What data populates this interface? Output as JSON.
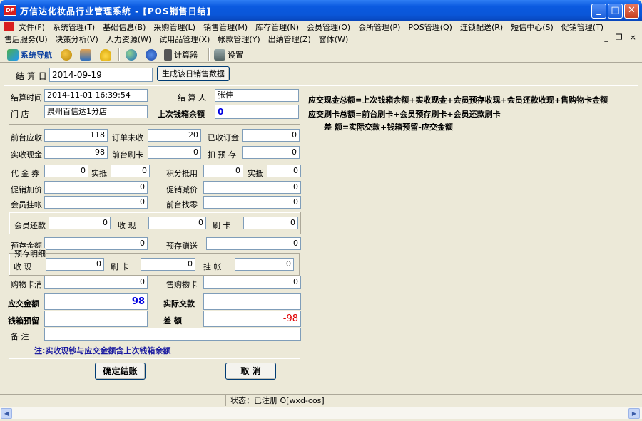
{
  "window": {
    "title": "万信达化妆品行业管理系统 - [POS销售日结]",
    "logo_text": "DF",
    "min_label": "_",
    "max_label": "□",
    "close_label": "✕"
  },
  "menu": {
    "row1": [
      "文件(F)",
      "系统管理(T)",
      "基础信息(B)",
      "采购管理(L)",
      "销售管理(M)",
      "库存管理(N)",
      "会员管理(O)",
      "会所管理(P)",
      "POS管理(Q)",
      "连锁配送(R)",
      "短信中心(S)",
      "促销管理(T)"
    ],
    "row2": [
      "售后服务(U)",
      "决策分析(V)",
      "人力资源(W)",
      "试用品管理(X)",
      "帐款管理(Y)",
      "出纳管理(Z)",
      "窗体(W)"
    ],
    "mdi": {
      "min": "_",
      "restore": "❐",
      "close": "×"
    }
  },
  "toolbar": {
    "nav_label": "系统导航",
    "calc_label": "计算器",
    "settings_label": "设置"
  },
  "form": {
    "settle_date_label": "结 算 日",
    "settle_date_value": "2014-09-19",
    "generate_btn": "生成该日销售数据",
    "settle_time_label": "结算时间",
    "settle_time_value": "2014-11-01 16:39:54",
    "settler_label": "结 算 人",
    "settler_value": "张佳",
    "store_label": "门    店",
    "store_value": "泉州百信达1分店",
    "last_cash_label": "上次钱箱余额",
    "last_cash_value": "0",
    "front_receivable_label": "前台应收",
    "front_receivable_value": "118",
    "unpaid_orders_label": "订单未收",
    "unpaid_orders_value": "20",
    "received_orders_label": "已收订金",
    "received_orders_value": "0",
    "cash_received_label": "实收现金",
    "cash_received_value": "98",
    "front_card_label": "前台刷卡",
    "front_card_value": "0",
    "prepaid_deduct_label": "扣 预 存",
    "prepaid_deduct_value": "0",
    "voucher_label": "代 金 券",
    "voucher_value": "0",
    "actual_offset_label": "实抵",
    "actual_offset_value": "0",
    "points_offset_label": "积分抵用",
    "points_offset_value": "0",
    "actual_offset2_label": "实抵",
    "actual_offset2_value": "0",
    "promo_markup_label": "促销加价",
    "promo_markup_value": "0",
    "promo_discount_label": "促销减价",
    "promo_discount_value": "0",
    "member_credit_label": "会员挂帐",
    "member_credit_value": "0",
    "front_change_label": "前台找零",
    "front_change_value": "0",
    "member_repay_label": "会员还款",
    "member_repay_value": "0",
    "repay_cash_label": "收    现",
    "repay_cash_value": "0",
    "repay_card_label": "刷    卡",
    "repay_card_value": "0",
    "prepaid_amount_label": "预存金额",
    "prepaid_amount_value": "0",
    "prepaid_gift_label": "预存赠送",
    "prepaid_gift_value": "0",
    "prepaid_detail_label": "预存明细",
    "detail_cash_label": "收    现",
    "detail_cash_value": "0",
    "detail_card_label": "刷    卡",
    "detail_card_value": "0",
    "detail_credit_label": "挂    帐",
    "detail_credit_value": "0",
    "card_consume_label": "购物卡消",
    "card_consume_value": "0",
    "card_sold_label": "售购物卡",
    "card_sold_value": "0",
    "due_label": "应交金额",
    "due_value": "98",
    "actual_paid_label": "实际交款",
    "actual_paid_value": "",
    "cash_reserve_label": "钱箱预留",
    "cash_reserve_value": "",
    "diff_label": "差    额",
    "diff_value": "-98",
    "remark_label": "备    注",
    "remark_value": "",
    "note": "注:实收现钞与应交金额含上次钱箱余额",
    "confirm_btn": "确定结账",
    "cancel_btn": "取  消"
  },
  "formulas": [
    "应交现金总额=上次钱箱余额+实收现金+会员预存收现+会员还款收现+售购物卡金额",
    "应交刷卡总额=前台刷卡+会员预存刷卡+会员还款刷卡",
    "差    额=实际交款+钱箱预留-应交金额"
  ],
  "status": {
    "text": "状态：已注册 O[wxd-cos]"
  },
  "colors": {
    "title_bar": "#0a56d8",
    "window_bg": "#ece9d8",
    "due_value": "#0000e0",
    "diff_value": "#e00000",
    "note": "#1a1aa0"
  }
}
